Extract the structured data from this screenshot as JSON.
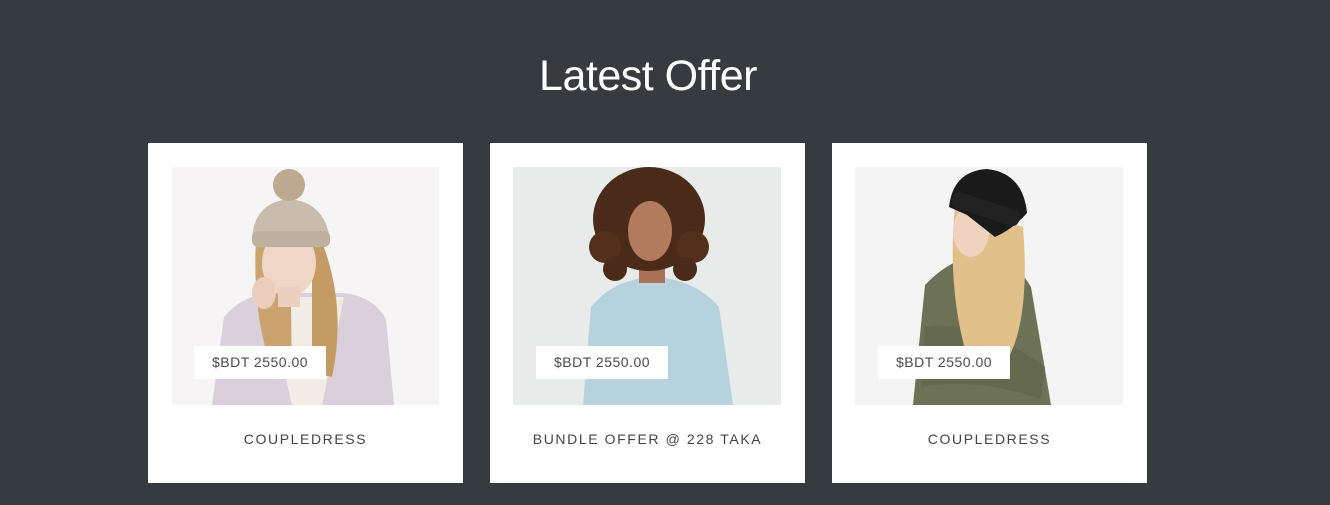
{
  "section": {
    "title": "Latest Offer"
  },
  "products": [
    {
      "name": "COUPLEDRESS",
      "price": "$BDT 2550.00",
      "image": "woman-in-beige-pom-pom-beanie-and-lilac-jacket"
    },
    {
      "name": "BUNDLE OFFER @ 228 TAKA",
      "price": "$BDT 2550.00",
      "image": "woman-with-curly-hair-in-light-blue-sweatshirt"
    },
    {
      "name": "COUPLEDRESS",
      "price": "$BDT 2550.00",
      "image": "woman-in-black-beanie-and-olive-green-sweater"
    }
  ],
  "colors": {
    "background": "#353b3f",
    "card": "#ffffff",
    "title_text": "#ffffff",
    "card_text": "#444444"
  }
}
